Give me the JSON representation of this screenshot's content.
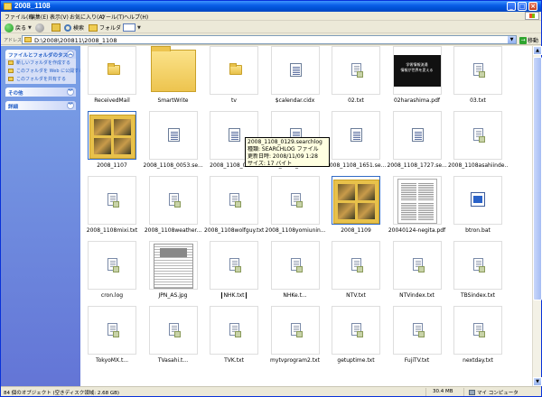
{
  "window": {
    "title": "2008_1108"
  },
  "menubar": {
    "items": [
      "ファイル(F)",
      "編集(E)",
      "表示(V)",
      "お気に入り(A)",
      "ツール(T)",
      "ヘルプ(H)"
    ]
  },
  "toolbar": {
    "back": "戻る",
    "search": "検索",
    "folders": "フォルダ"
  },
  "address": {
    "label": "アドレス(D)",
    "path": "D:\\2008\\200811\\2008_1108",
    "go": "移動"
  },
  "taskpane": {
    "tasks_title": "ファイルとフォルダのタスク",
    "tasks": [
      "新しいフォルダを作成する",
      "このフォルダを Web に公開する",
      "このフォルダを共有する"
    ],
    "other_title": "その他",
    "details_title": "詳細"
  },
  "files": [
    {
      "name": "ReceivedMail",
      "kind": "folder"
    },
    {
      "name": "SmartWrite",
      "kind": "bigfolder"
    },
    {
      "name": "tv",
      "kind": "folder"
    },
    {
      "name": "$calendar.cidx",
      "kind": "doc"
    },
    {
      "name": "02.txt",
      "kind": "txt"
    },
    {
      "name": "02harashima.pdf",
      "kind": "pdfblack"
    },
    {
      "name": "03.txt",
      "kind": "txt"
    },
    {
      "name": "2008_1107",
      "kind": "photofolder"
    },
    {
      "name": "2008_1108_0053.se...",
      "kind": "doc"
    },
    {
      "name": "2008_1108_012...",
      "kind": "doc"
    },
    {
      "name": "2008_1108_0129.se...",
      "kind": "doc"
    },
    {
      "name": "2008_1108_1651.se...",
      "kind": "doc"
    },
    {
      "name": "2008_1108_1727.se...",
      "kind": "doc"
    },
    {
      "name": "2008_1108asahiinde...",
      "kind": "txt"
    },
    {
      "name": "2008_1108mixi.txt",
      "kind": "txt"
    },
    {
      "name": "2008_1108weather...",
      "kind": "txt"
    },
    {
      "name": "2008_1108wolfguy.txt",
      "kind": "txt"
    },
    {
      "name": "2008_1108yomiunin...",
      "kind": "txt"
    },
    {
      "name": "2008_1109",
      "kind": "photofolder"
    },
    {
      "name": "20040124-negita.pdf",
      "kind": "pdf2"
    },
    {
      "name": "btron.bat",
      "kind": "btron"
    },
    {
      "name": "cron.log",
      "kind": "txt"
    },
    {
      "name": "JPN_AS.jpg",
      "kind": "news"
    },
    {
      "name": "NHK.txt",
      "kind": "txt",
      "renaming": true
    },
    {
      "name": "NHKe.t...",
      "kind": "txt"
    },
    {
      "name": "NTV.txt",
      "kind": "txt"
    },
    {
      "name": "NTVindex.txt",
      "kind": "txt"
    },
    {
      "name": "TBSindex.txt",
      "kind": "txt"
    },
    {
      "name": "TokyoMX.t...",
      "kind": "txt"
    },
    {
      "name": "TVasahi.t...",
      "kind": "txt"
    },
    {
      "name": "TVK.txt",
      "kind": "txt"
    },
    {
      "name": "mytvprogram2.txt",
      "kind": "txt"
    },
    {
      "name": "getuptime.txt",
      "kind": "txt"
    },
    {
      "name": "FujiTV.txt",
      "kind": "txt"
    },
    {
      "name": "nextday.txt",
      "kind": "txt"
    }
  ],
  "pdf_black_lines": [
    "学術情報流通",
    "情報が世界を変える"
  ],
  "tooltip": {
    "line1": "2008_1108_0129.searchlog",
    "line2": "種類: SEARCHLOG ファイル",
    "line3": "更新日時: 2008/11/09 1:28",
    "line4": "サイズ: 17 バイト"
  },
  "status": {
    "left": "84 個のオブジェクト (空きディスク領域: 2.68 GB)",
    "size": "30.4 MB",
    "zone": "マイ コンピュータ"
  },
  "colors": {
    "titlebar": "#0a5ee8",
    "taskpane": "#6f8bdf",
    "tooltip": "#ffffe1"
  }
}
